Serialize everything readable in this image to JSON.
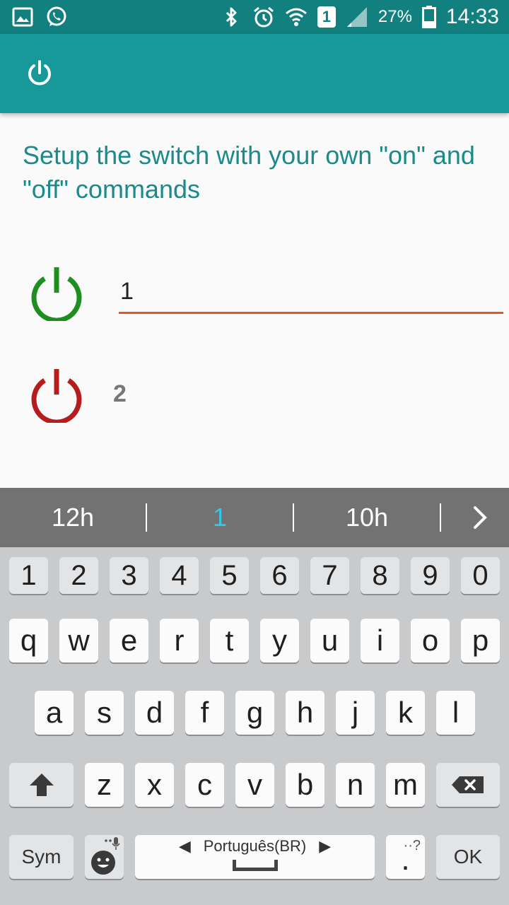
{
  "status_bar": {
    "battery": "27%",
    "time": "14:33",
    "sim_slot": "1",
    "icons": [
      "gallery-icon",
      "whatsapp-icon",
      "bluetooth-icon",
      "alarm-icon",
      "wifi-icon",
      "sim-icon",
      "signal-icon",
      "battery-icon"
    ]
  },
  "app_bar": {
    "icon": "power-icon"
  },
  "main": {
    "headline": "Setup the switch with your own \"on\" and \"off\" commands",
    "on_command": {
      "value": "1",
      "icon": "power-on-icon",
      "icon_color": "#1e8f1e",
      "underline_color": "#e0562a"
    },
    "off_command": {
      "value": "2",
      "icon": "power-off-icon",
      "icon_color": "#b71c1c"
    }
  },
  "suggestions": {
    "items": [
      {
        "label": "12h"
      },
      {
        "label": "1"
      },
      {
        "label": "10h"
      }
    ],
    "active_index": 1,
    "active_color": "#35c5e5"
  },
  "keyboard": {
    "number_row": [
      "1",
      "2",
      "3",
      "4",
      "5",
      "6",
      "7",
      "8",
      "9",
      "0"
    ],
    "row1": [
      "q",
      "w",
      "e",
      "r",
      "t",
      "y",
      "u",
      "i",
      "o",
      "p"
    ],
    "row2": [
      "a",
      "s",
      "d",
      "f",
      "g",
      "h",
      "j",
      "k",
      "l"
    ],
    "row3": [
      "z",
      "x",
      "c",
      "v",
      "b",
      "n",
      "m"
    ],
    "sym_label": "Sym",
    "space_label": "Português(BR)",
    "period_label": ".",
    "period_hint": "··?",
    "ok_label": "OK"
  },
  "colors": {
    "status_bar": "#11807f",
    "app_bar": "#17999a",
    "headline": "#1a8a8a",
    "keyboard_bg": "#c9cacc",
    "suggestion_bg": "#727272"
  }
}
